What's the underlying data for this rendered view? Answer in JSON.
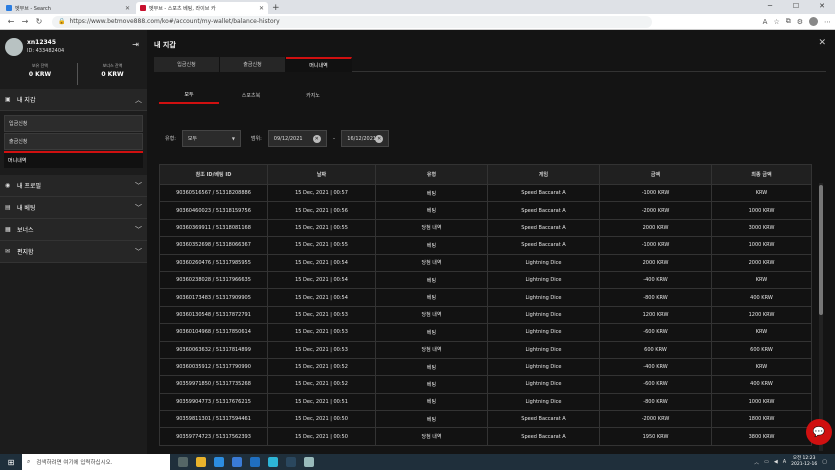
{
  "browser": {
    "tabs": [
      {
        "label": "벳무브 - Search",
        "active": false,
        "favicon_color": "#2b7de1"
      },
      {
        "label": "벳무브 - 스포츠 베팅, 라이브 카",
        "active": true,
        "favicon_color": "#c8102e"
      }
    ],
    "new_tab": "+",
    "url": "https://www.betmove888.com/ko#/account/my-wallet/balance-history"
  },
  "sidebar": {
    "username": "xn12345",
    "user_id": "ID: 433482404",
    "balances": [
      {
        "label": "보유 잔액",
        "value": "0 KRW"
      },
      {
        "label": "보너스 잔액",
        "value": "0 KRW"
      }
    ],
    "menu": [
      {
        "label": "내 지갑",
        "icon": "wallet-icon",
        "expanded": true,
        "items": [
          {
            "label": "입금신청",
            "active": false
          },
          {
            "label": "출금신청",
            "active": false
          },
          {
            "label": "머니내역",
            "active": true
          }
        ]
      },
      {
        "label": "내 프로필",
        "icon": "profile-icon",
        "expanded": false
      },
      {
        "label": "내 베팅",
        "icon": "bets-icon",
        "expanded": false
      },
      {
        "label": "보너스",
        "icon": "gift-icon",
        "expanded": false
      },
      {
        "label": "편지함",
        "icon": "mail-icon",
        "expanded": false
      }
    ]
  },
  "main": {
    "title": "내 지갑",
    "tabs": [
      {
        "label": "입금신청",
        "active": false
      },
      {
        "label": "출금신청",
        "active": false
      },
      {
        "label": "머니내역",
        "active": true
      }
    ],
    "subtabs": [
      {
        "label": "모두",
        "active": true
      },
      {
        "label": "스포츠북",
        "active": false
      },
      {
        "label": "카지노",
        "active": false
      }
    ],
    "filters": {
      "type_label": "유형:",
      "type_value": "모두",
      "range_label": "범위:",
      "date_from": "09/12/2021",
      "date_to": "16/12/2021",
      "separator": "–"
    },
    "table": {
      "headers": [
        "참조 ID/베팅 ID",
        "날짜",
        "유형",
        "게임",
        "금액",
        "최종 금액"
      ],
      "rows": [
        [
          "90360516567 / 51318208886",
          "15 Dec, 2021 | 00:57",
          "베팅",
          "Speed Baccarat A",
          "-1000 KRW",
          "KRW"
        ],
        [
          "90360460023 / 51318159756",
          "15 Dec, 2021 | 00:56",
          "베팅",
          "Speed Baccarat A",
          "-2000 KRW",
          "1000 KRW"
        ],
        [
          "90360369911 / 51318081168",
          "15 Dec, 2021 | 00:55",
          "당첨 내역",
          "Speed Baccarat A",
          "2000 KRW",
          "3000 KRW"
        ],
        [
          "90360352698 / 51318066367",
          "15 Dec, 2021 | 00:55",
          "베팅",
          "Speed Baccarat A",
          "-1000 KRW",
          "1000 KRW"
        ],
        [
          "90360260476 / 51317985955",
          "15 Dec, 2021 | 00:54",
          "당첨 내역",
          "Lightning Dice",
          "2000 KRW",
          "2000 KRW"
        ],
        [
          "90360238028 / 51317966635",
          "15 Dec, 2021 | 00:54",
          "베팅",
          "Lightning Dice",
          "-400 KRW",
          "KRW"
        ],
        [
          "90360173483 / 51317909905",
          "15 Dec, 2021 | 00:54",
          "베팅",
          "Lightning Dice",
          "-800 KRW",
          "400 KRW"
        ],
        [
          "90360130548 / 51317872791",
          "15 Dec, 2021 | 00:53",
          "당첨 내역",
          "Lightning Dice",
          "1200 KRW",
          "1200 KRW"
        ],
        [
          "90360104968 / 51317850614",
          "15 Dec, 2021 | 00:53",
          "베팅",
          "Lightning Dice",
          "-600 KRW",
          "KRW"
        ],
        [
          "90360063632 / 51317814899",
          "15 Dec, 2021 | 00:53",
          "당첨 내역",
          "Lightning Dice",
          "600 KRW",
          "600 KRW"
        ],
        [
          "90360035912 / 51317790990",
          "15 Dec, 2021 | 00:52",
          "베팅",
          "Lightning Dice",
          "-400 KRW",
          "KRW"
        ],
        [
          "90359971850 / 51317735268",
          "15 Dec, 2021 | 00:52",
          "베팅",
          "Lightning Dice",
          "-600 KRW",
          "400 KRW"
        ],
        [
          "90359904773 / 51317676215",
          "15 Dec, 2021 | 00:51",
          "베팅",
          "Lightning Dice",
          "-800 KRW",
          "1000 KRW"
        ],
        [
          "90359811301 / 51317594461",
          "15 Dec, 2021 | 00:50",
          "베팅",
          "Speed Baccarat A",
          "-2000 KRW",
          "1800 KRW"
        ],
        [
          "90359774723 / 51317562393",
          "15 Dec, 2021 | 00:50",
          "당첨 내역",
          "Speed Baccarat A",
          "1950 KRW",
          "3800 KRW"
        ]
      ]
    }
  },
  "taskbar": {
    "search_placeholder": "검색하려면 여기에 입력하십시오.",
    "time": "오전 12:23",
    "date": "2021-12-16"
  },
  "colors": {
    "accent": "#d01010",
    "page_bg": "#141414",
    "sidebar_bg": "#1c1c1c"
  }
}
